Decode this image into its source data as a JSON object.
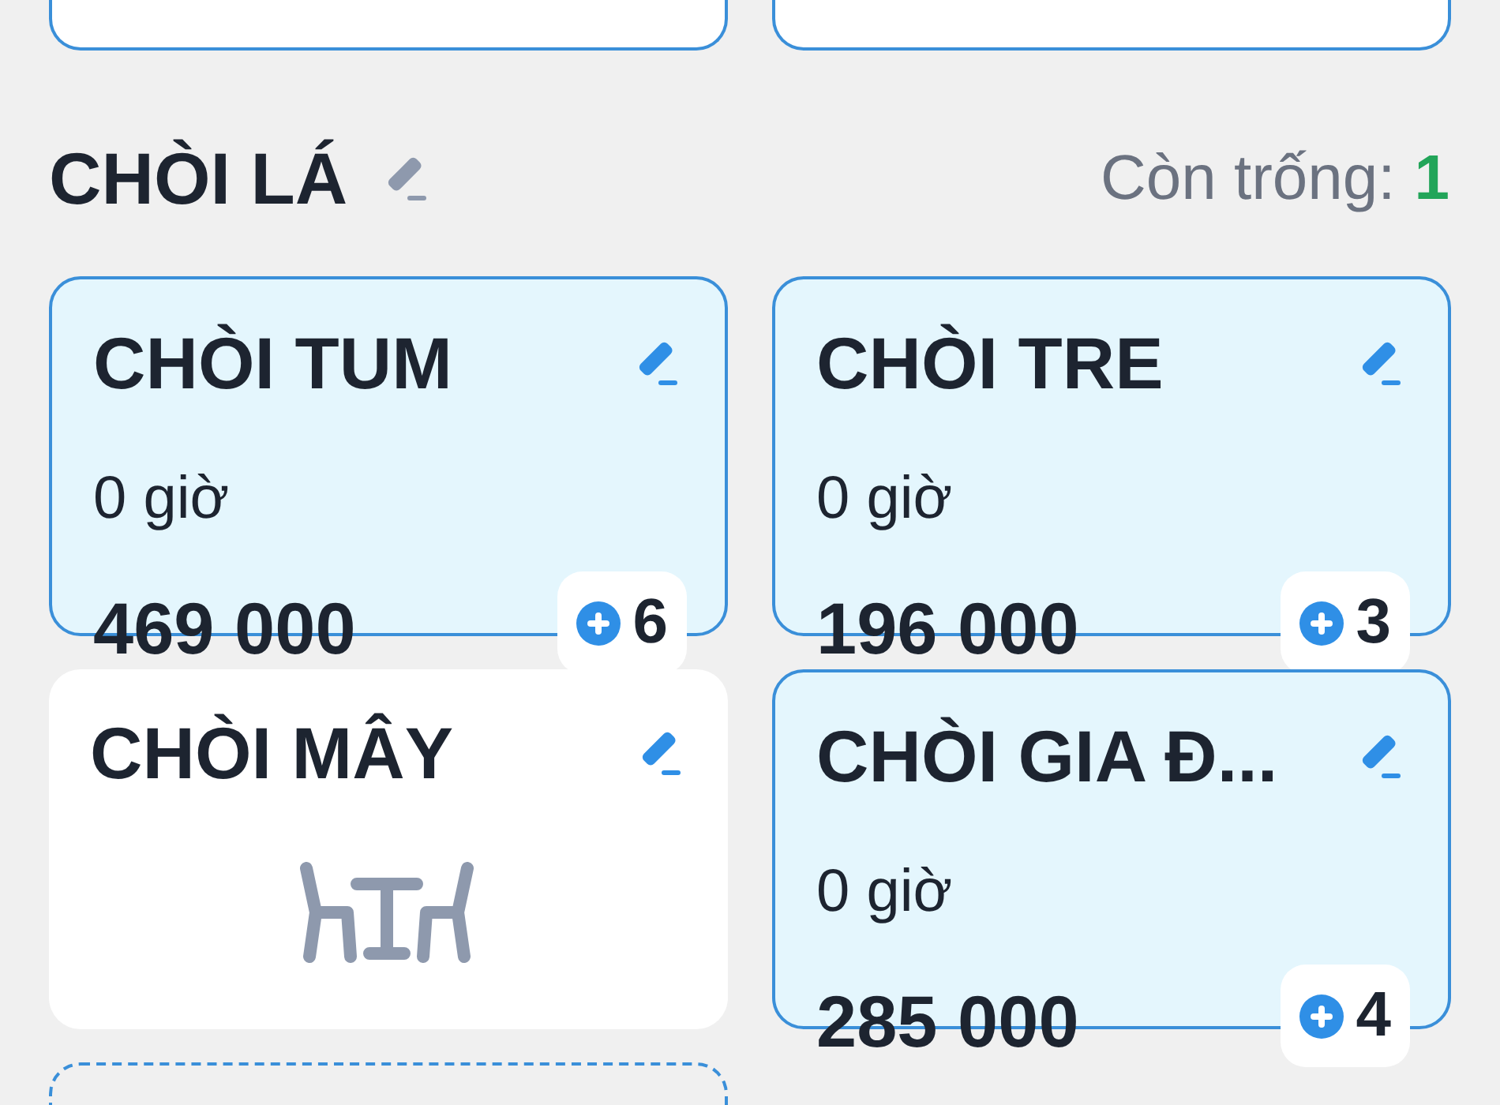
{
  "previous_section": {
    "tables": [
      {
        "kind": "partial"
      },
      {
        "kind": "partial"
      }
    ]
  },
  "section": {
    "title": "CHÒI LÁ",
    "availability_label": "Còn trống:",
    "availability_count": "1",
    "tables": [
      {
        "kind": "occupied",
        "name": "CHÒI TUM",
        "duration": "0 giờ",
        "price": "469 000",
        "count": "6"
      },
      {
        "kind": "occupied",
        "name": "CHÒI TRE",
        "duration": "0 giờ",
        "price": "196 000",
        "count": "3"
      },
      {
        "kind": "empty",
        "name": "CHÒI MÂY"
      },
      {
        "kind": "occupied",
        "name": "CHÒI GIA Đ...",
        "duration": "0 giờ",
        "price": "285 000",
        "count": "4"
      },
      {
        "kind": "add"
      }
    ]
  }
}
